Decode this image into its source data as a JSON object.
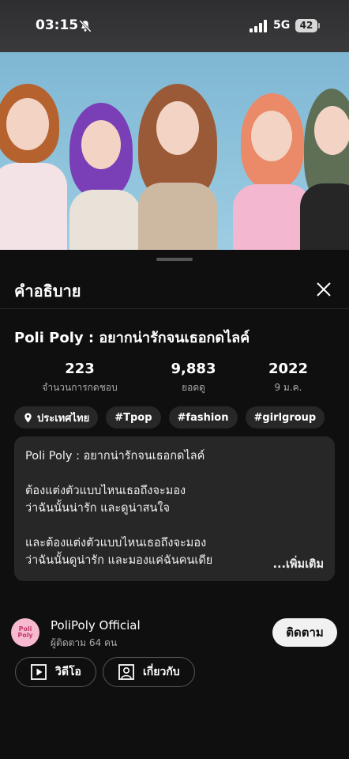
{
  "status_bar": {
    "time": "03:15",
    "network": "5G",
    "battery": "42"
  },
  "sheet": {
    "title": "คำอธิบาย"
  },
  "video": {
    "title": "Poli Poly : อยากน่ารักจนเธอกดไลค์",
    "stats": [
      {
        "value": "223",
        "label": "จำนวนการกดชอบ"
      },
      {
        "value": "9,883",
        "label": "ยอดดู"
      },
      {
        "value": "2022",
        "label": "9 ม.ค."
      }
    ],
    "tags": [
      "ประเทศไทย",
      "#Tpop",
      "#fashion",
      "#girlgroup"
    ]
  },
  "description": {
    "lines": [
      "Poli Poly : อยากน่ารักจนเธอกดไลค์",
      "",
      "ต้องแต่งตัวแบบไหนเธอถึงจะมอง",
      "ว่าฉันนั้นน่ารัก และดูน่าสนใจ",
      "",
      "และต้องแต่งตัวแบบไหนเธอถึงจะมอง",
      "ว่าฉันนั้นดูน่ารัก และมองแค่ฉันคนเดีย"
    ],
    "more_label": "...เพิ่มเติม"
  },
  "channel": {
    "avatar_text": "Poli Poly",
    "name": "PoliPoly Official",
    "subscribers": "ผู้ติดตาม 64 คน",
    "subscribe_label": "ติดตาม"
  },
  "buttons": {
    "videos_label": "วิดีโอ",
    "about_label": "เกี่ยวกับ"
  },
  "icons": {
    "bell": "bell-slash-icon",
    "close": "close-icon",
    "location": "location-pin-icon",
    "video": "play-box-icon",
    "about": "person-box-icon"
  }
}
